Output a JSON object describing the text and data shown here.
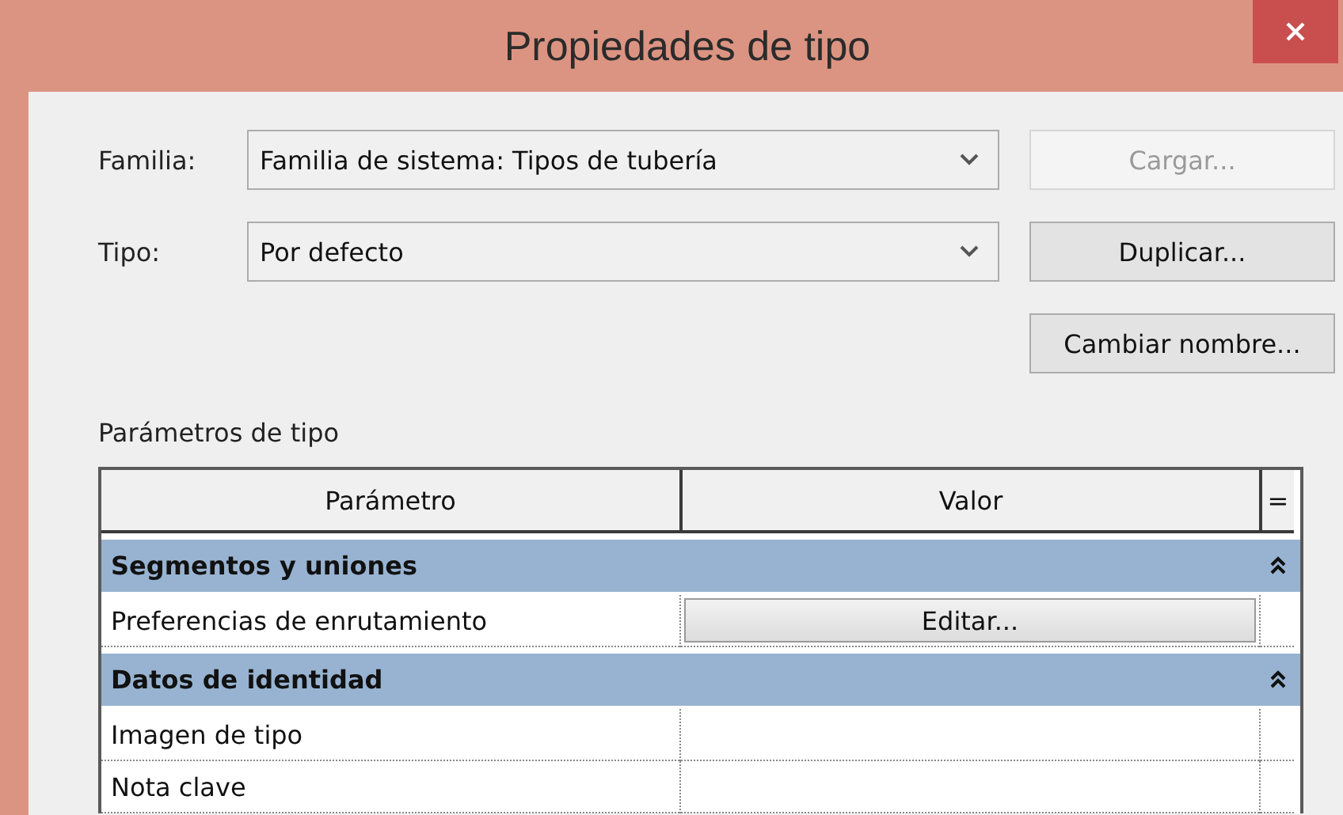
{
  "window": {
    "title": "Propiedades de tipo"
  },
  "fields": [
    {
      "label": "Familia:",
      "value": "Familia de sistema: Tipos de tubería"
    },
    {
      "label": "Tipo:",
      "value": "Por defecto"
    }
  ],
  "buttons": [
    {
      "label": "Cargar...",
      "disabled": true
    },
    {
      "label": "Duplicar...",
      "disabled": false
    },
    {
      "label": "Cambiar nombre...",
      "disabled": false
    }
  ],
  "table": {
    "title": "Parámetros de tipo",
    "columns": [
      "Parámetro",
      "Valor",
      "="
    ],
    "groups": [
      {
        "name": "Segmentos y uniones",
        "expanded": true,
        "rows": [
          {
            "parameter": "Preferencias de enrutamiento",
            "kind": "button",
            "value": "Editar..."
          }
        ]
      },
      {
        "name": "Datos de identidad",
        "expanded": true,
        "rows": [
          {
            "parameter": "Imagen de tipo",
            "kind": "empty"
          },
          {
            "parameter": "Nota clave",
            "kind": "empty"
          }
        ]
      }
    ]
  }
}
